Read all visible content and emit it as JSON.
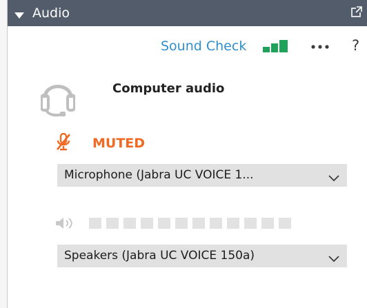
{
  "panel": {
    "title": "Audio",
    "icons": {
      "collapse": "caret-down-icon",
      "popout": "pop-out-icon"
    }
  },
  "toolbar": {
    "sound_check": "Sound Check",
    "signal_icon": "signal-bars-icon",
    "more_icon": "more-options-icon",
    "help": "?"
  },
  "audio": {
    "connection": "Computer audio",
    "headset_icon": "headset-icon"
  },
  "microphone": {
    "status": "MUTED",
    "status_color": "#f06a24",
    "icon": "muted-microphone-icon",
    "device": "Microphone  (Jabra  UC  VOICE 1..."
  },
  "speaker": {
    "icon": "speaker-icon",
    "level_segments": 12,
    "level_filled": 0,
    "device": "Speakers (Jabra UC VOICE 150a)"
  },
  "colors": {
    "titlebar": "#525c6b",
    "accent": "#2f8fc8",
    "signal": "#1fa35b"
  }
}
